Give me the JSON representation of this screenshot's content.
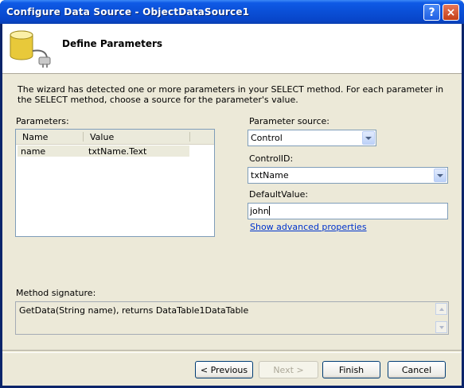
{
  "window": {
    "title": "Configure Data Source - ObjectDataSource1",
    "help_label": "?",
    "close_label": "×"
  },
  "header": {
    "title": "Define Parameters",
    "icon": "database-plug-icon"
  },
  "description": "The wizard has detected one or more parameters in your SELECT method. For each parameter in the SELECT method, choose a source for the parameter's value.",
  "parameters": {
    "label": "Parameters:",
    "columns": [
      "Name",
      "Value"
    ],
    "rows": [
      {
        "name": "name",
        "value": "txtName.Text"
      }
    ]
  },
  "parameter_source": {
    "label": "Parameter source:",
    "value": "Control"
  },
  "control_id": {
    "label": "ControlID:",
    "value": "txtName"
  },
  "default_value": {
    "label": "DefaultValue:",
    "value": "john"
  },
  "advanced_link": "Show advanced properties",
  "method_signature": {
    "label": "Method signature:",
    "value": "GetData(String name), returns DataTable1DataTable"
  },
  "buttons": {
    "previous": "< Previous",
    "next": "Next >",
    "finish": "Finish",
    "cancel": "Cancel"
  },
  "colors": {
    "titlebar": "#0a4fd6",
    "dialog_bg": "#ece9d8",
    "link": "#0033cc"
  }
}
